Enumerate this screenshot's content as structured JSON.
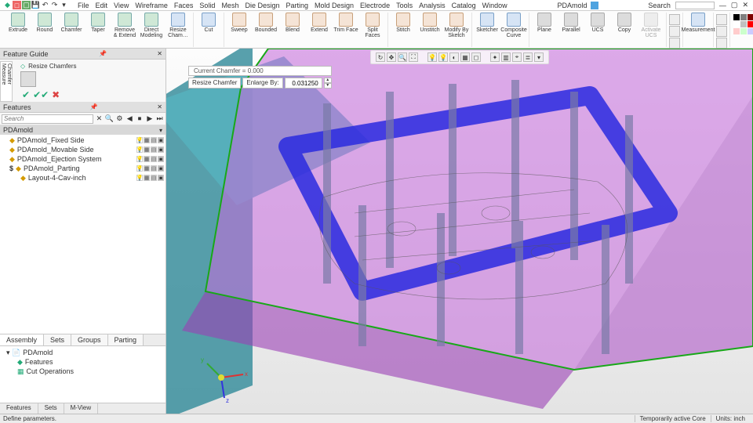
{
  "app": {
    "document": "PDAmold",
    "search_label": "Search"
  },
  "menus": [
    "File",
    "Edit",
    "View",
    "Wireframe",
    "Faces",
    "Solid",
    "Mesh",
    "Die Design",
    "Parting",
    "Mold Design",
    "Electrode",
    "Tools",
    "Analysis",
    "Catalog",
    "Window"
  ],
  "ribbon": {
    "g1": [
      "Extrude",
      "Round",
      "Chamfer",
      "Taper",
      "Remove & Extend",
      "Direct Modeling",
      "Resize Cham…"
    ],
    "g2": [
      "Cut"
    ],
    "g3": [
      "Sweep",
      "Bounded",
      "Blend",
      "Extend",
      "Trim Face",
      "Split Faces"
    ],
    "g4": [
      "Stitch",
      "Unstitch",
      "Modify By Sketch"
    ],
    "g5": [
      "Sketcher",
      "Composite Curve"
    ],
    "g6": [
      "Plane",
      "Parallel",
      "UCS",
      "Copy",
      "Activate UCS"
    ],
    "g7": [
      "Measurement"
    ]
  },
  "feature_guide": {
    "title": "Feature Guide",
    "command": "Resize Chamfers",
    "left_tab": "Chamfer  Measure"
  },
  "features_panel": {
    "title": "Features",
    "search_placeholder": "Search",
    "root": "PDAmold",
    "nodes": [
      {
        "label": "PDAmold_Fixed Side"
      },
      {
        "label": "PDAmold_Movable Side"
      },
      {
        "label": "PDAmold_Ejection System"
      },
      {
        "label": "PDAmold_Parting",
        "dollar": true
      },
      {
        "label": "Layout-4-Cav-inch",
        "child": true
      }
    ]
  },
  "lower_tabs": [
    "Assembly",
    "Sets",
    "Groups",
    "Parting"
  ],
  "lower_tree": {
    "root": "PDAmold",
    "items": [
      "Features",
      "Cut Operations"
    ]
  },
  "bottom_tabs": [
    "Features",
    "Sets",
    "M-View"
  ],
  "chamfer": {
    "current": "Current Chamfer = 0.000",
    "btn": "Resize Chamfer",
    "label": "Enlarge By:",
    "value": "0.031250"
  },
  "status": {
    "left": "Define parameters.",
    "temp": "Temporarily active  Core",
    "units": "Units: inch"
  },
  "palette": [
    "#000",
    "#808080",
    "#800000",
    "#808000",
    "#008000",
    "#008080",
    "#000080",
    "#800080",
    "#c0c0c0",
    "#fff",
    "#c0c0c0",
    "#f00",
    "#ff0",
    "#0f0",
    "#0ff",
    "#00f",
    "#f0f",
    "#fff",
    "#fcc",
    "#cfc",
    "#ccf",
    "#ffc",
    "#cff",
    "#fcf",
    "#eee",
    "#ccc",
    "#aaa"
  ]
}
